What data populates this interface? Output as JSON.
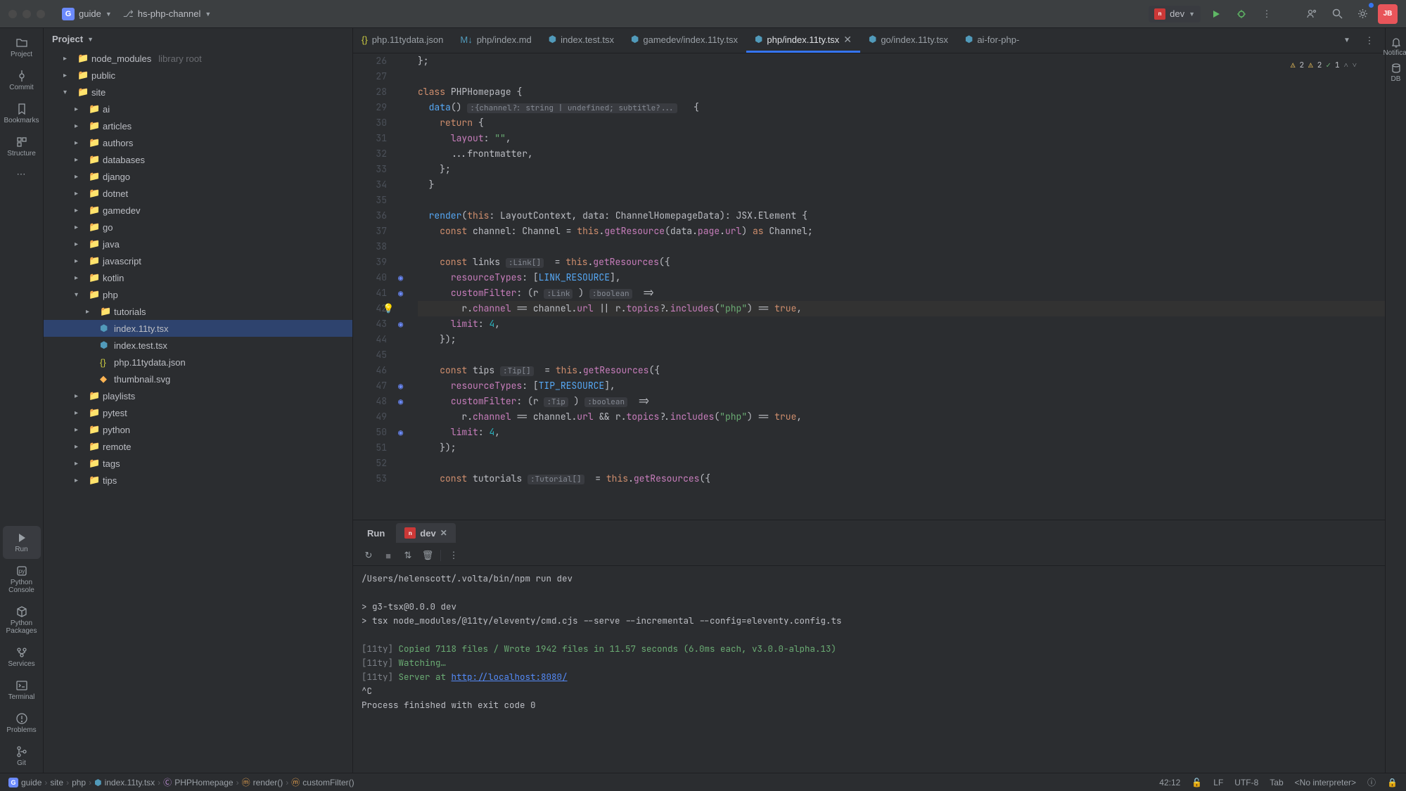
{
  "titlebar": {
    "project": "guide",
    "branch": "hs-php-channel",
    "run_config": "dev"
  },
  "sidebar": {
    "items": [
      {
        "label": "Project",
        "icon": "folder"
      },
      {
        "label": "Commit",
        "icon": "commit"
      },
      {
        "label": "Bookmarks",
        "icon": "bookmark"
      },
      {
        "label": "Structure",
        "icon": "structure"
      },
      {
        "label": "",
        "icon": "more"
      }
    ],
    "items_bottom": [
      {
        "label": "Run",
        "icon": "play",
        "active": true
      },
      {
        "label": "Python Console",
        "icon": "py"
      },
      {
        "label": "Python Packages",
        "icon": "pkg"
      },
      {
        "label": "Services",
        "icon": "services"
      },
      {
        "label": "Terminal",
        "icon": "terminal"
      },
      {
        "label": "Problems",
        "icon": "warning"
      },
      {
        "label": "Git",
        "icon": "git"
      }
    ]
  },
  "right_rail": {
    "items": [
      {
        "label": "Notificat",
        "icon": "bell"
      },
      {
        "label": "DB",
        "icon": "db"
      }
    ]
  },
  "project_panel": {
    "title": "Project"
  },
  "tree": [
    {
      "indent": 1,
      "chevron": "right",
      "icon": "folder",
      "label": "node_modules",
      "extra": "library root"
    },
    {
      "indent": 1,
      "chevron": "right",
      "icon": "folder",
      "label": "public"
    },
    {
      "indent": 1,
      "chevron": "down",
      "icon": "folder",
      "label": "site"
    },
    {
      "indent": 2,
      "chevron": "right",
      "icon": "folder",
      "label": "ai"
    },
    {
      "indent": 2,
      "chevron": "right",
      "icon": "folder",
      "label": "articles"
    },
    {
      "indent": 2,
      "chevron": "right",
      "icon": "folder",
      "label": "authors"
    },
    {
      "indent": 2,
      "chevron": "right",
      "icon": "folder",
      "label": "databases"
    },
    {
      "indent": 2,
      "chevron": "right",
      "icon": "folder",
      "label": "django"
    },
    {
      "indent": 2,
      "chevron": "right",
      "icon": "folder",
      "label": "dotnet"
    },
    {
      "indent": 2,
      "chevron": "right",
      "icon": "folder",
      "label": "gamedev"
    },
    {
      "indent": 2,
      "chevron": "right",
      "icon": "folder",
      "label": "go"
    },
    {
      "indent": 2,
      "chevron": "right",
      "icon": "folder",
      "label": "java"
    },
    {
      "indent": 2,
      "chevron": "right",
      "icon": "folder",
      "label": "javascript"
    },
    {
      "indent": 2,
      "chevron": "right",
      "icon": "folder",
      "label": "kotlin"
    },
    {
      "indent": 2,
      "chevron": "down",
      "icon": "folder",
      "label": "php"
    },
    {
      "indent": 3,
      "chevron": "right",
      "icon": "folder",
      "label": "tutorials"
    },
    {
      "indent": 3,
      "chevron": "",
      "icon": "tsx",
      "label": "index.11ty.tsx",
      "selected": true
    },
    {
      "indent": 3,
      "chevron": "",
      "icon": "tsx",
      "label": "index.test.tsx"
    },
    {
      "indent": 3,
      "chevron": "",
      "icon": "json",
      "label": "php.11tydata.json"
    },
    {
      "indent": 3,
      "chevron": "",
      "icon": "svg",
      "label": "thumbnail.svg"
    },
    {
      "indent": 2,
      "chevron": "right",
      "icon": "folder",
      "label": "playlists"
    },
    {
      "indent": 2,
      "chevron": "right",
      "icon": "folder",
      "label": "pytest"
    },
    {
      "indent": 2,
      "chevron": "right",
      "icon": "folder",
      "label": "python"
    },
    {
      "indent": 2,
      "chevron": "right",
      "icon": "folder",
      "label": "remote"
    },
    {
      "indent": 2,
      "chevron": "right",
      "icon": "folder",
      "label": "tags"
    },
    {
      "indent": 2,
      "chevron": "right",
      "icon": "folder",
      "label": "tips"
    }
  ],
  "tabs": [
    {
      "icon": "json",
      "label": "php.11tydata.json"
    },
    {
      "icon": "md",
      "label": "php/index.md"
    },
    {
      "icon": "tsx",
      "label": "index.test.tsx"
    },
    {
      "icon": "tsx",
      "label": "gamedev/index.11ty.tsx"
    },
    {
      "icon": "tsx",
      "label": "php/index.11ty.tsx",
      "active": true,
      "closable": true
    },
    {
      "icon": "tsx",
      "label": "go/index.11ty.tsx"
    },
    {
      "icon": "tsx",
      "label": "ai-for-php-"
    }
  ],
  "warnings": {
    "w1": "2",
    "w2": "2",
    "typo": "1"
  },
  "gutter_start": 26,
  "code_lines": [
    {
      "n": 26,
      "html": "<span class='op'>};</span>"
    },
    {
      "n": 27,
      "html": ""
    },
    {
      "n": 28,
      "html": "<span class='kw'>class</span> <span class='type'>PHPHomepage</span> <span class='op'>{</span>"
    },
    {
      "n": 29,
      "html": "  <span class='fn'>data</span>() <span class='hint'>:{channel?: string | undefined; subtitle?...</span>   <span class='op'>{</span>"
    },
    {
      "n": 30,
      "html": "    <span class='kw'>return</span> <span class='op'>{</span>"
    },
    {
      "n": 31,
      "html": "      <span class='prop'>layout</span>: <span class='str'>\"\"</span>,"
    },
    {
      "n": 32,
      "html": "      ...<span class='type'>frontmatter</span>,"
    },
    {
      "n": 33,
      "html": "    <span class='op'>};</span>"
    },
    {
      "n": 34,
      "html": "  <span class='op'>}</span>"
    },
    {
      "n": 35,
      "html": ""
    },
    {
      "n": 36,
      "html": "  <span class='fn'>render</span>(<span class='kw'>this</span>: <span class='type'>LayoutContext</span>, <span class='type'>data</span>: <span class='type'>ChannelHomepageData</span>): <span class='type'>JSX</span>.<span class='type'>Element</span> <span class='op'>{</span>"
    },
    {
      "n": 37,
      "html": "    <span class='kw'>const</span> <span class='type'>channel</span>: <span class='type'>Channel</span> = <span class='kw'>this</span>.<span class='fn2'>getResource</span>(<span class='type'>data</span>.<span class='prop'>page</span>.<span class='prop'>url</span>) <span class='kw'>as</span> <span class='type'>Channel</span>;"
    },
    {
      "n": 38,
      "html": ""
    },
    {
      "n": 39,
      "html": "    <span class='kw'>const</span> <span class='type'>links</span> <span class='hint'>:Link[]</span>  = <span class='kw'>this</span>.<span class='fn2'>getResources</span>({"
    },
    {
      "n": 40,
      "html": "      <span class='prop'>resourceTypes</span>: [<span class='fn'>LINK_RESOURCE</span>],",
      "usage": true
    },
    {
      "n": 41,
      "html": "      <span class='prop'>customFilter</span>: (<span class='type'>r</span> <span class='hint'>:Link</span> ) <span class='hint'>:boolean</span>  =>",
      "usage": true
    },
    {
      "n": 42,
      "html": "        <span class='type'>r</span>.<span class='prop'>channel</span> == <span class='type'>channel</span>.<span class='prop'>url</span> || <span class='type'>r</span>.<span class='prop'>topics</span>?.<span class='fn2'>includes</span>(<span class='str'>\"php\"</span>) == <span class='true'>true</span>,",
      "hl": true,
      "bulb": true
    },
    {
      "n": 43,
      "html": "      <span class='prop'>limit</span>: <span class='num'>4</span>,",
      "usage": true
    },
    {
      "n": 44,
      "html": "    <span class='op'>});</span>"
    },
    {
      "n": 45,
      "html": ""
    },
    {
      "n": 46,
      "html": "    <span class='kw'>const</span> <span class='type'>tips</span> <span class='hint'>:Tip[]</span>  = <span class='kw'>this</span>.<span class='fn2'>getResources</span>({"
    },
    {
      "n": 47,
      "html": "      <span class='prop'>resourceTypes</span>: [<span class='fn'>TIP_RESOURCE</span>],",
      "usage": true
    },
    {
      "n": 48,
      "html": "      <span class='prop'>customFilter</span>: (<span class='type'>r</span> <span class='hint'>:Tip</span> ) <span class='hint'>:boolean</span>  =>",
      "usage": true
    },
    {
      "n": 49,
      "html": "        <span class='type'>r</span>.<span class='prop'>channel</span> == <span class='type'>channel</span>.<span class='prop'>url</span> && <span class='type'>r</span>.<span class='prop'>topics</span>?.<span class='fn2'>includes</span>(<span class='str'>\"php\"</span>) == <span class='true'>true</span>,"
    },
    {
      "n": 50,
      "html": "      <span class='prop'>limit</span>: <span class='num'>4</span>,",
      "usage": true
    },
    {
      "n": 51,
      "html": "    <span class='op'>});</span>"
    },
    {
      "n": 52,
      "html": ""
    },
    {
      "n": 53,
      "html": "    <span class='kw'>const</span> <span class='type'>tutorials</span> <span class='hint'>:Tutorial[]</span>  = <span class='kw'>this</span>.<span class='fn2'>getResources</span>({"
    }
  ],
  "run_panel": {
    "tab1": "Run",
    "tab2": "dev",
    "lines": [
      {
        "text": "/Users/helenscott/.volta/bin/npm run dev",
        "cls": ""
      },
      {
        "text": "",
        "cls": ""
      },
      {
        "text": "> g3-tsx@0.0.0 dev",
        "cls": ""
      },
      {
        "text": "> tsx node_modules/@11ty/eleventy/cmd.cjs --serve --incremental --config=eleventy.config.ts",
        "cls": ""
      },
      {
        "text": "",
        "cls": ""
      },
      {
        "prefix": "[11ty]",
        "text": " Copied 7118 files / Wrote 1942 files in 11.57 seconds (6.0ms each, v3.0.0-alpha.13)",
        "cls": "cl-green"
      },
      {
        "prefix": "[11ty]",
        "text": " Watching…",
        "cls": "cl-green"
      },
      {
        "prefix": "[11ty]",
        "text": " Server at ",
        "link": "http://localhost:8080/",
        "cls": "cl-green"
      },
      {
        "text": "^C",
        "cls": ""
      },
      {
        "text": "Process finished with exit code 0",
        "cls": ""
      }
    ]
  },
  "breadcrumbs": [
    {
      "icon": "g",
      "label": "guide"
    },
    {
      "label": "site"
    },
    {
      "label": "php"
    },
    {
      "icon": "tsx",
      "label": "index.11ty.tsx"
    },
    {
      "icon": "class",
      "label": "PHPHomepage"
    },
    {
      "icon": "method",
      "label": "render()"
    },
    {
      "icon": "method",
      "label": "customFilter()"
    }
  ],
  "statusbar": {
    "pos": "42:12",
    "lf": "LF",
    "encoding": "UTF-8",
    "indent": "Tab",
    "interpreter": "<No interpreter>"
  }
}
